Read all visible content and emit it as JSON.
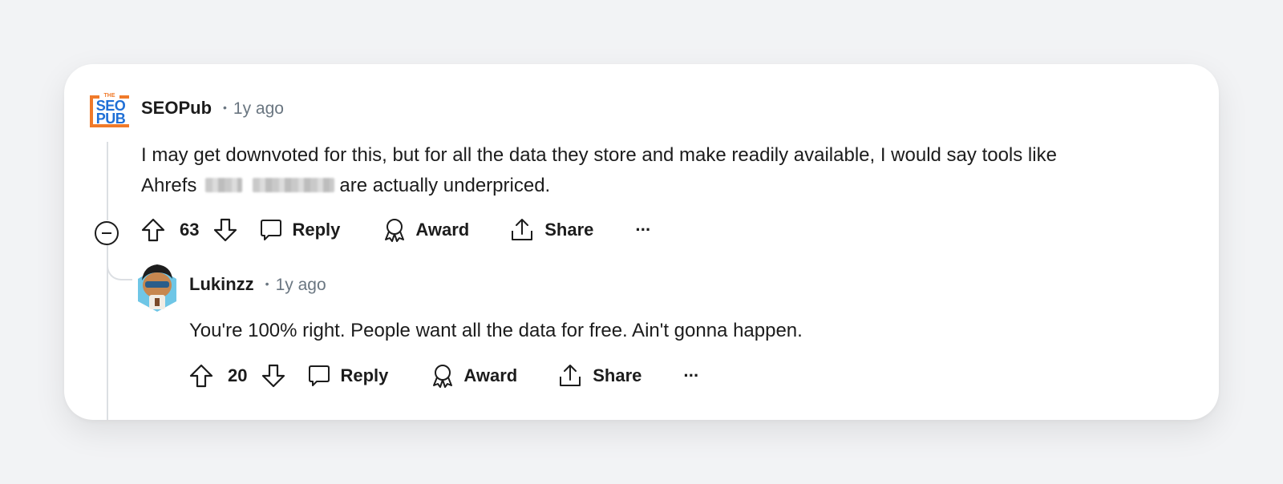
{
  "comments": [
    {
      "author": "SEOPub",
      "avatar_text_top": "THE",
      "avatar_text_mid": "SEO",
      "avatar_text_bot": "PUB",
      "time": "1y ago",
      "body_line1": "I may get downvoted for this, but for all the data they store and make readily available, I would say tools like",
      "body_line2_start": "Ahrefs",
      "body_line2_end": "are actually underpriced.",
      "votes": "63",
      "reply_label": "Reply",
      "award_label": "Award",
      "share_label": "Share",
      "more_label": "···"
    },
    {
      "author": "Lukinzz",
      "time": "1y ago",
      "body": "You're 100% right. People want all the data for free. Ain't gonna happen.",
      "votes": "20",
      "reply_label": "Reply",
      "award_label": "Award",
      "share_label": "Share",
      "more_label": "···"
    }
  ],
  "colors": {
    "seo_orange": "#f07a2a",
    "seo_blue": "#1f6fd6",
    "thread_line": "#dcdfe3",
    "meta_gray": "#6a7681"
  }
}
